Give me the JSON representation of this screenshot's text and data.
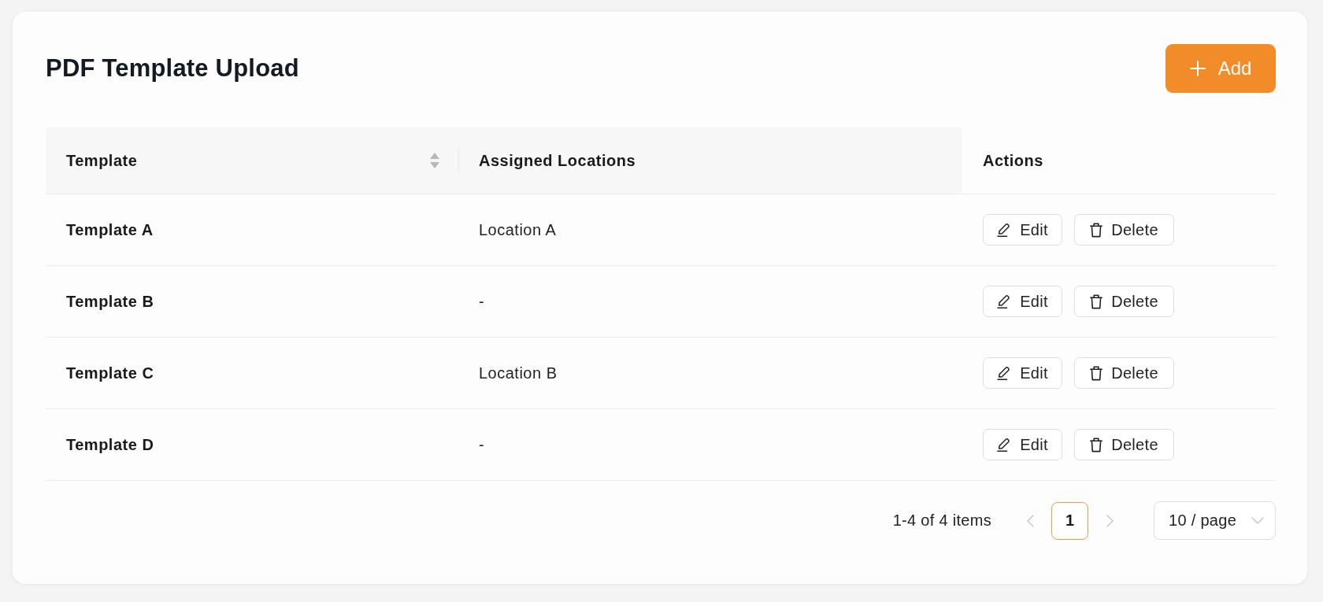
{
  "page": {
    "title": "PDF Template Upload",
    "add_button": {
      "label": "Add"
    }
  },
  "table": {
    "columns": [
      {
        "label": "Template",
        "sortable": true
      },
      {
        "label": "Assigned Locations",
        "sortable": false
      },
      {
        "label": "Actions",
        "sortable": false
      }
    ],
    "rows": [
      {
        "template": "Template A",
        "locations": "Location A",
        "actions": [
          {
            "kind": "edit",
            "label": "Edit"
          },
          {
            "kind": "delete",
            "label": "Delete"
          }
        ]
      },
      {
        "template": "Template B",
        "locations": "-",
        "actions": [
          {
            "kind": "edit",
            "label": "Edit"
          },
          {
            "kind": "delete",
            "label": "Delete"
          }
        ]
      },
      {
        "template": "Template C",
        "locations": "Location B",
        "actions": [
          {
            "kind": "edit",
            "label": "Edit"
          },
          {
            "kind": "delete",
            "label": "Delete"
          }
        ]
      },
      {
        "template": "Template D",
        "locations": "-",
        "actions": [
          {
            "kind": "edit",
            "label": "Edit"
          },
          {
            "kind": "delete",
            "label": "Delete"
          }
        ]
      }
    ]
  },
  "pagination": {
    "summary": "1-4 of 4 items",
    "previous": {
      "disabled": true
    },
    "pages": [
      {
        "label": "1",
        "selected": true
      }
    ],
    "next": {
      "disabled": true
    },
    "page_size": "10 / page"
  }
}
